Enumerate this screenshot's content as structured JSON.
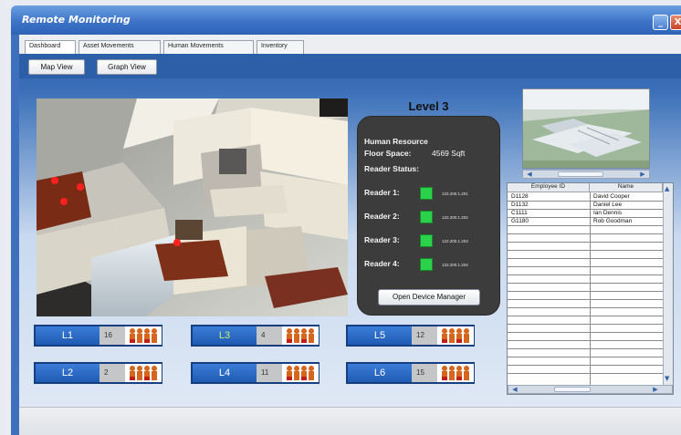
{
  "window": {
    "title": "Remote Monitoring",
    "minimize_glyph": "_",
    "close_glyph": "X"
  },
  "tabs": [
    {
      "label": "Dashboard",
      "active": true
    },
    {
      "label": "Asset Movements",
      "active": false
    },
    {
      "label": "Human Movements",
      "active": false
    },
    {
      "label": "Inventory",
      "active": false
    }
  ],
  "views": {
    "map_label": "Map View",
    "graph_label": "Graph View"
  },
  "device": {
    "level_title": "Level 3",
    "department": "Human Resource",
    "floor_space_label": "Floor Space:",
    "floor_space_value": "4569 Sqft",
    "reader_status_label": "Reader Status:",
    "readers": [
      {
        "label": "Reader 1:",
        "ip": "122.200.1.201",
        "status_color": "#2bd14a"
      },
      {
        "label": "Reader 2:",
        "ip": "122.200.1.202",
        "status_color": "#2bd14a"
      },
      {
        "label": "Reader 3:",
        "ip": "122.200.1.203",
        "status_color": "#2bd14a"
      },
      {
        "label": "Reader 4:",
        "ip": "122.200.1.204",
        "status_color": "#2bd14a"
      }
    ],
    "open_button": "Open Device Manager"
  },
  "employees": {
    "headers": [
      "Employee ID",
      "Name"
    ],
    "rows": [
      [
        "D1128",
        "David Cooper"
      ],
      [
        "D1132",
        "Daniel Lee"
      ],
      [
        "C1111",
        "Ian Dennis"
      ],
      [
        "G1180",
        "Rob Goodman"
      ]
    ]
  },
  "levels": [
    {
      "name": "L1",
      "count": "16",
      "highlight": false
    },
    {
      "name": "L3",
      "count": "4",
      "highlight": true
    },
    {
      "name": "L5",
      "count": "12",
      "highlight": false
    },
    {
      "name": "L2",
      "count": "2",
      "highlight": false
    },
    {
      "name": "L4",
      "count": "11",
      "highlight": false
    },
    {
      "name": "L6",
      "count": "15",
      "highlight": false
    }
  ],
  "icons": {
    "people": "people-group-icon",
    "status": "reader-status-icon"
  },
  "colors": {
    "accent": "#2c5fa8",
    "reader_ok": "#2bd14a",
    "level_highlight": "#c8f06a"
  }
}
